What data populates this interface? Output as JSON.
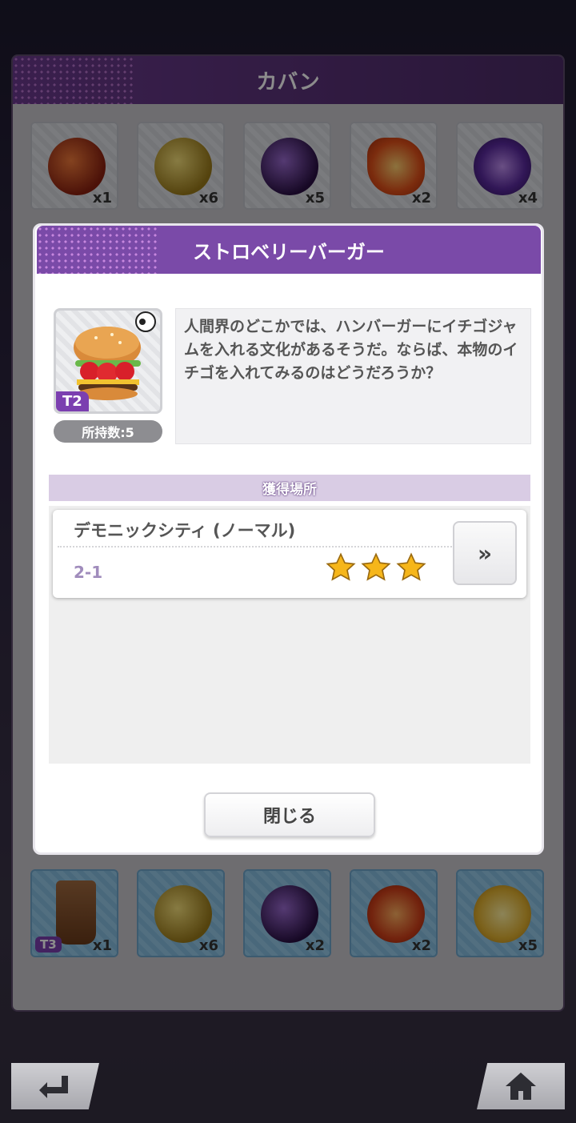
{
  "bag": {
    "title": "カバン",
    "top_row": [
      {
        "icon": "fire-orb-icon",
        "qty": "x1",
        "color": "#b33a1a"
      },
      {
        "icon": "light-orb-icon",
        "qty": "x6",
        "color": "#c89a2a"
      },
      {
        "icon": "dark-orb-icon",
        "qty": "x5",
        "color": "#4a2a6e"
      },
      {
        "icon": "fire-crystal-icon",
        "qty": "x2",
        "color": "#e0701e"
      },
      {
        "icon": "dark-crystal-icon",
        "qty": "x4",
        "color": "#5a2a8e"
      }
    ],
    "bottom_row": [
      {
        "icon": "bubble-tea-icon",
        "qty": "x1",
        "tier": "T3"
      },
      {
        "icon": "light-orb-icon",
        "qty": "x6"
      },
      {
        "icon": "dark-orb-icon",
        "qty": "x2"
      },
      {
        "icon": "fire-crystal-icon",
        "qty": "x2"
      },
      {
        "icon": "light-crystal-icon",
        "qty": "x5"
      }
    ]
  },
  "modal": {
    "title": "ストロベリーバーガー",
    "item": {
      "icon": "strawberry-burger-icon",
      "tier": "T2",
      "owned": "所持数:5"
    },
    "description": "人間界のどこかでは、ハンバーガーにイチゴジャムを入れる文化があるそうだ。ならば、本物のイチゴを入れてみるのはどうだろうか？",
    "acquisition_header": "獲得場所",
    "acquisition": {
      "location": "デモニックシティ (ノーマル)",
      "stage": "2-1",
      "stars": 3,
      "go_label": "»"
    },
    "close_label": "閉じる"
  },
  "nav": {
    "back_icon": "back-arrow-icon",
    "home_icon": "home-icon"
  }
}
